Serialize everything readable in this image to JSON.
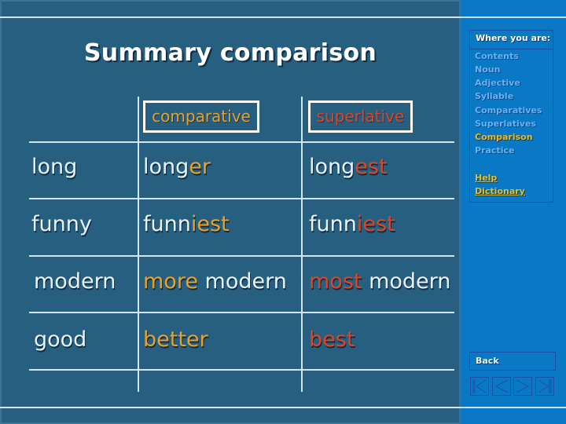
{
  "title": "Summary comparison",
  "table": {
    "headers": {
      "comparative": "comparative",
      "superlative": "superlative"
    },
    "rows": [
      {
        "base": "long",
        "comparative": {
          "stem": "long",
          "suffix": "er",
          "rest": ""
        },
        "superlative": {
          "stem": "long",
          "suffix": "est",
          "rest": ""
        }
      },
      {
        "base": "funny",
        "comparative": {
          "stem": "funn",
          "suffix": "iest",
          "rest": ""
        },
        "superlative": {
          "stem": "funn",
          "suffix": "iest",
          "rest": ""
        }
      },
      {
        "base": "modern",
        "comparative": {
          "stem": "",
          "suffix": "more",
          "rest": " modern"
        },
        "superlative": {
          "stem": "",
          "suffix": "most",
          "rest": " modern"
        }
      },
      {
        "base": "good",
        "comparative": {
          "stem": "",
          "suffix": "better",
          "rest": ""
        },
        "superlative": {
          "stem": "",
          "suffix": "best",
          "rest": ""
        }
      }
    ]
  },
  "sidebar": {
    "heading": "Where you are:",
    "items": [
      {
        "label": "Contents",
        "current": false
      },
      {
        "label": "Noun",
        "current": false
      },
      {
        "label": "Adjective",
        "current": false
      },
      {
        "label": "Syllable",
        "current": false
      },
      {
        "label": "Comparatives",
        "current": false
      },
      {
        "label": "Superlatives",
        "current": false
      },
      {
        "label": "Comparison",
        "current": true
      },
      {
        "label": "Practice",
        "current": false
      }
    ],
    "links": [
      "Help",
      "Dictionary"
    ],
    "back_label": "Back",
    "nav_buttons": [
      "first-icon",
      "previous-icon",
      "next-icon",
      "last-icon"
    ]
  },
  "colors": {
    "background": "#275f80",
    "sidebar": "#0a79c5",
    "comparative_accent": "#e9a12d",
    "superlative_accent": "#dc4626",
    "text": "#e8f4fb"
  }
}
